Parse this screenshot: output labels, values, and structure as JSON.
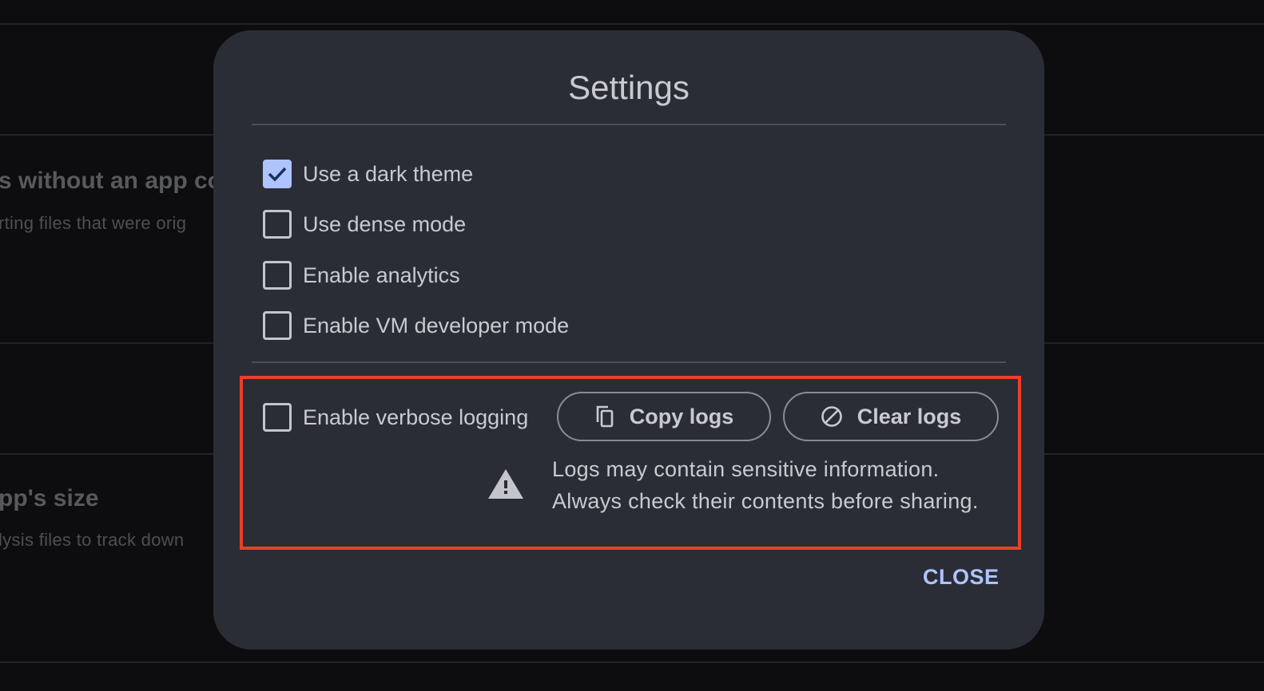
{
  "background": {
    "sections": [
      {
        "title": "s without an app co",
        "subtitle": "rting files that were orig"
      },
      {
        "title": "pp's size",
        "subtitle": "lysis files to track down"
      }
    ]
  },
  "dialog": {
    "title": "Settings",
    "options": [
      {
        "label": "Use a dark theme",
        "checked": true
      },
      {
        "label": "Use dense mode",
        "checked": false
      },
      {
        "label": "Enable analytics",
        "checked": false
      },
      {
        "label": "Enable VM developer mode",
        "checked": false
      }
    ],
    "logging": {
      "verbose_label": "Enable verbose logging",
      "verbose_checked": false,
      "copy_button": {
        "label": "Copy logs",
        "icon": "copy-icon"
      },
      "clear_button": {
        "label": "Clear logs",
        "icon": "block-icon"
      },
      "warning_icon": "warning-icon",
      "warning_line1": "Logs may contain sensitive information.",
      "warning_line2": "Always check their contents before sharing."
    },
    "close_label": "CLOSE"
  },
  "colors": {
    "accent": "#afc4ff",
    "dialog_bg": "#2b2d36",
    "page_bg": "#0d0d0f",
    "highlight": "#e8412a",
    "text": "#c9cad0"
  }
}
